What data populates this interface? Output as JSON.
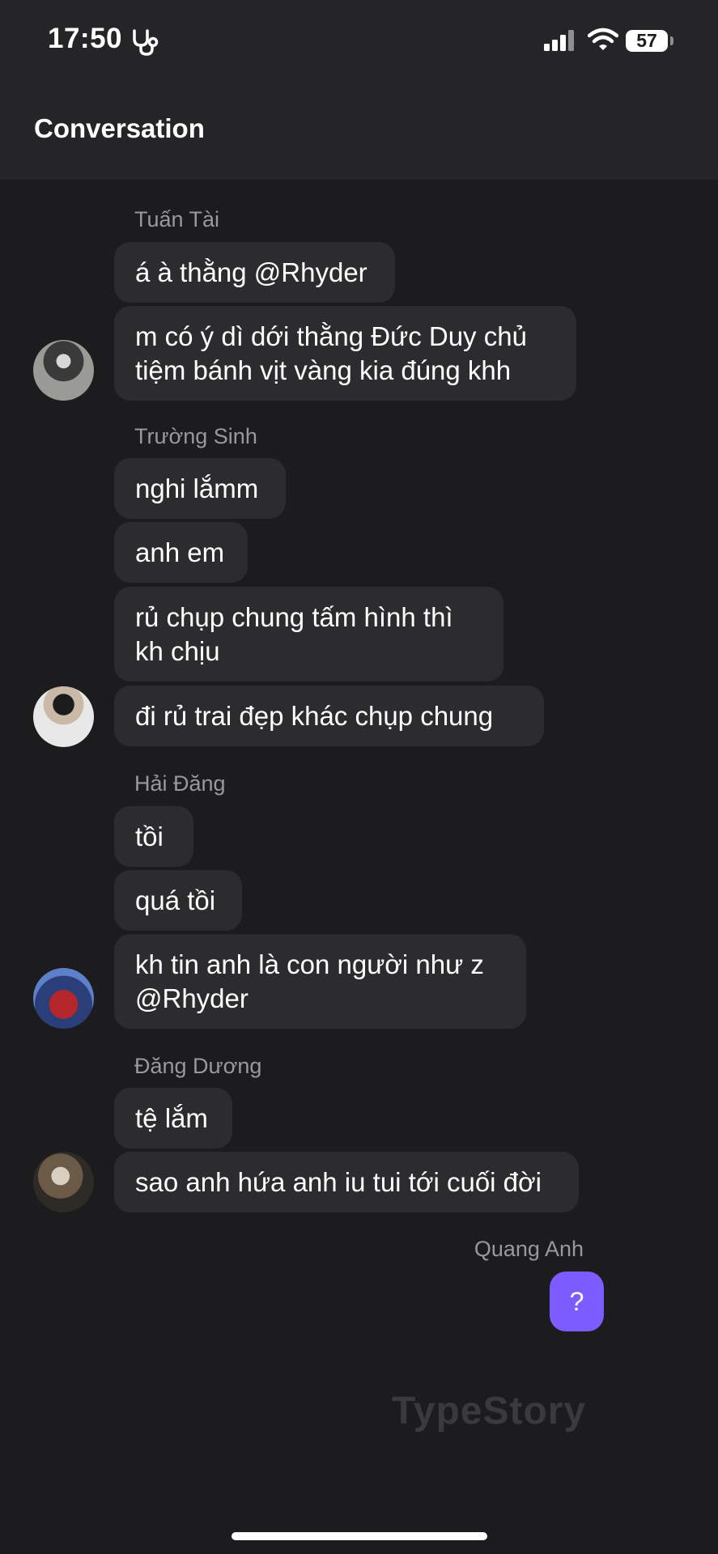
{
  "status_bar": {
    "time": "17:50",
    "battery": "57"
  },
  "header": {
    "title": "Conversation"
  },
  "groups": [
    {
      "sender": "Tuấn Tài",
      "messages": [
        "á à thằng @Rhyder",
        "m có ý dì dới thằng Đức Duy chủ tiệm bánh vịt vàng kia đúng khh"
      ]
    },
    {
      "sender": "Trường Sinh",
      "messages": [
        "nghi lắmm",
        "anh em",
        "rủ chụp chung tấm hình thì kh chịu",
        "đi rủ trai đẹp khác chụp chung"
      ]
    },
    {
      "sender": "Hải Đăng",
      "messages": [
        "tồi",
        "quá tồi",
        "kh tin anh là con người như z @Rhyder"
      ]
    },
    {
      "sender": "Đăng Dương",
      "messages": [
        "tệ lắm",
        "sao anh hứa anh iu tui tới cuối đời"
      ]
    }
  ],
  "outgoing": {
    "sender": "Quang Anh",
    "message": "?"
  },
  "watermark": "TypeStory",
  "colors": {
    "background": "#1c1c1e",
    "header": "#252527",
    "bubble": "#2c2c2e",
    "accent": "#7c5cff"
  }
}
